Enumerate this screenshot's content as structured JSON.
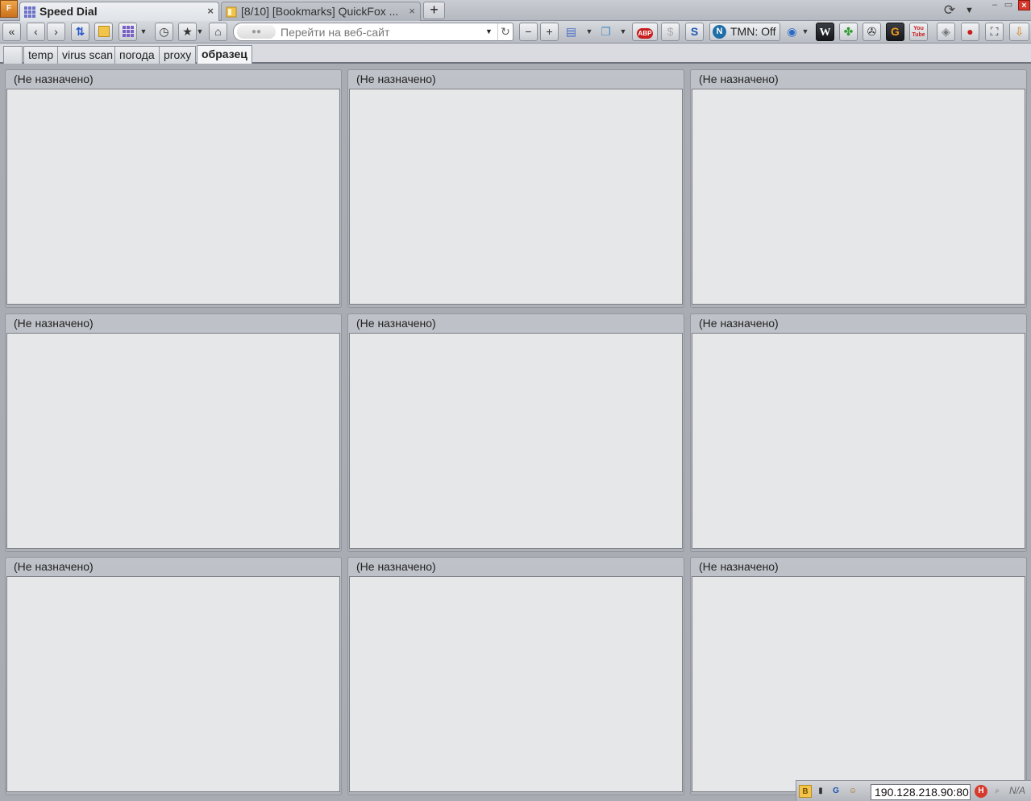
{
  "app": {
    "menu_button_label": "F"
  },
  "tabs": [
    {
      "label": "Speed Dial",
      "active": true
    },
    {
      "label": "[8/10] [Bookmarks] QuickFox ...",
      "active": false
    }
  ],
  "tabstrip": {
    "new_tab_label": "+",
    "close_glyph": "×"
  },
  "navbar": {
    "url_placeholder": "Перейти на веб-сайт",
    "tmn_label": "TMN: Off",
    "youtube_label": "You Tube",
    "abp_label": "ABP"
  },
  "groups": [
    {
      "label": "",
      "active": false
    },
    {
      "label": "temp",
      "active": false
    },
    {
      "label": "virus scan",
      "active": false
    },
    {
      "label": "погода",
      "active": false
    },
    {
      "label": "proxy",
      "active": false
    },
    {
      "label": "образец",
      "active": true
    }
  ],
  "dials": [
    {
      "title": "(Не назначено)"
    },
    {
      "title": "(Не назначено)"
    },
    {
      "title": "(Не назначено)"
    },
    {
      "title": "(Не назначено)"
    },
    {
      "title": "(Не назначено)"
    },
    {
      "title": "(Не назначено)"
    },
    {
      "title": "(Не назначено)"
    },
    {
      "title": "(Не назначено)"
    },
    {
      "title": "(Не назначено)"
    }
  ],
  "statusbar": {
    "ip_value": "190.128.218.90:80",
    "na_text": "N/A"
  },
  "colors": {
    "accent_orange": "#e8902f",
    "close_red": "#d63a2c",
    "thumb_bg": "#e6e7e9"
  }
}
